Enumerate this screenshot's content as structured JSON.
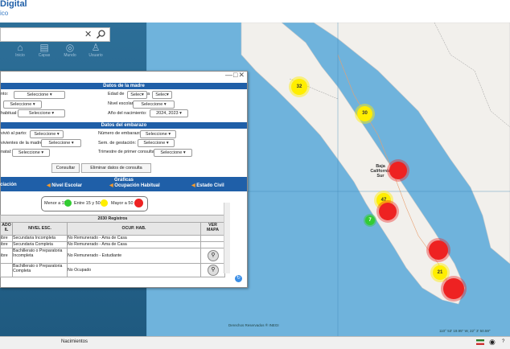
{
  "header": {
    "title": "Digital",
    "subtitle": "ico"
  },
  "toolbar": {
    "tools": [
      {
        "label": "Inicio",
        "icon": "house-icon"
      },
      {
        "label": "Capas",
        "icon": "layers-icon"
      },
      {
        "label": "Mundo",
        "icon": "globe-icon"
      },
      {
        "label": "Usuario",
        "icon": "person-icon"
      }
    ]
  },
  "window": {
    "controls": "—□✕",
    "madre": {
      "title": "Datos de la madre",
      "lugar_label": "nto:",
      "lugar_value": "Seleccione",
      "edad_label": "Edad de",
      "edad_from": "Selec",
      "edad_a": "a",
      "edad_to": "Selec",
      "row2_value": "Seleccione",
      "nivel_label": "Nivel escolar:",
      "nivel_value": "Seleccione",
      "habitual_label": "habitual:",
      "habitual_value": "Seleccione",
      "anio_label": "Año del nacimiento:",
      "anio_value": "2024, 2023"
    },
    "embarazo": {
      "title": "Datos del embarazo",
      "vivo_label": "vivió al parto:",
      "vivo_value": "Seleccione",
      "num_label": "Número de embarazo:",
      "num_value": "Seleccione",
      "vivientes_label": "vivientes de la madre:",
      "vivientes_value": "Seleccione",
      "sem_label": "Sem. de gestación:",
      "sem_value": "Seleccione",
      "natal_label": "natal:",
      "natal_value": "Seleccione",
      "trim_label": "Trimestre de primer consulta:",
      "trim_value": "Seleccione"
    },
    "buttons": {
      "consultar": "Consultar",
      "eliminar": "Eliminar datos de consulta"
    },
    "graficas": {
      "title": "Gráficas",
      "tabs": [
        "ciación",
        "Nivel Escolar",
        "Ocupación Habitual",
        "Estado Civil"
      ]
    },
    "legend": {
      "menor": "Menor a 15",
      "entre": "Entre 15 y 50",
      "mayor": "Mayor a 50",
      "colors": {
        "low": "#33cc33",
        "mid": "#ffee00",
        "high": "#ee2222"
      }
    },
    "table": {
      "count": "2030 Registros",
      "headers": [
        "ADO\nIL",
        "NIVEL ESC.",
        "OCUP. HAB.",
        "VER\nMAPA"
      ],
      "rows": [
        {
          "c0": "ibre",
          "c1": "Secundaria Incompleta",
          "c2": "No Remunerado - Ama de Casa",
          "map": false
        },
        {
          "c0": "ibre",
          "c1": "Secundaria Completa",
          "c2": "No Remunerado - Ama de Casa",
          "map": false
        },
        {
          "c0": "ibre",
          "c1": "Bachillerato o Preparatoria Incompleta",
          "c2": "No Remunerado - Estudiante",
          "map": true
        },
        {
          "c0": "",
          "c1": "Bachillerato o Preparatoria Completa",
          "c2": "No Ocupado",
          "map": true
        }
      ]
    }
  },
  "map": {
    "clusters": [
      {
        "label": "32",
        "color": "yellow"
      },
      {
        "label": "30",
        "color": "yellow"
      },
      {
        "label": "",
        "color": "red"
      },
      {
        "label": "47",
        "color": "yellow"
      },
      {
        "label": "",
        "color": "red"
      },
      {
        "label": "7",
        "color": "green"
      },
      {
        "label": "",
        "color": "red"
      },
      {
        "label": "21",
        "color": "yellow"
      },
      {
        "label": "",
        "color": "red"
      }
    ],
    "place_label": "Baja California Sur",
    "attribution": "Derechos Reservados ® INEGI",
    "coords": "110° 53' 19.95\" W, 22° 3' 50.59\""
  },
  "status": {
    "tab": "Nacimientos",
    "right": "?"
  }
}
